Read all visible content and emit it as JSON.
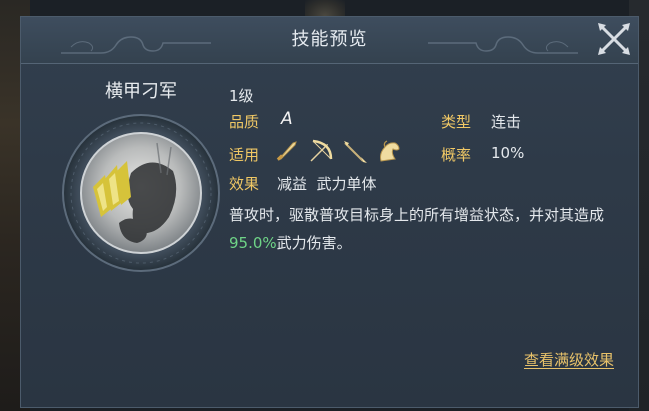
{
  "dialog": {
    "title": "技能预览",
    "close_icon": "close-x-icon"
  },
  "skill": {
    "name": "横甲刁军",
    "level": "1级",
    "quality_label": "品质",
    "quality_value": "A",
    "type_label": "类型",
    "type_value": "连击",
    "apply_label": "适用",
    "apply_icons": [
      "sword-icon",
      "bow-icon",
      "spear-icon",
      "horse-icon"
    ],
    "rate_label": "概率",
    "rate_value": "10%",
    "effect_label": "效果",
    "effect_value": "减益  武力单体",
    "description_pre": "普攻时，驱散普攻目标身上的所有增益状态，并对其造成",
    "description_pct": "95.0%",
    "description_post": "武力伤害。"
  },
  "actions": {
    "view_max_level": "查看满级效果"
  },
  "colors": {
    "label_gold": "#f0c865",
    "highlight_green": "#6fd487",
    "link_gold": "#e8c26a"
  }
}
